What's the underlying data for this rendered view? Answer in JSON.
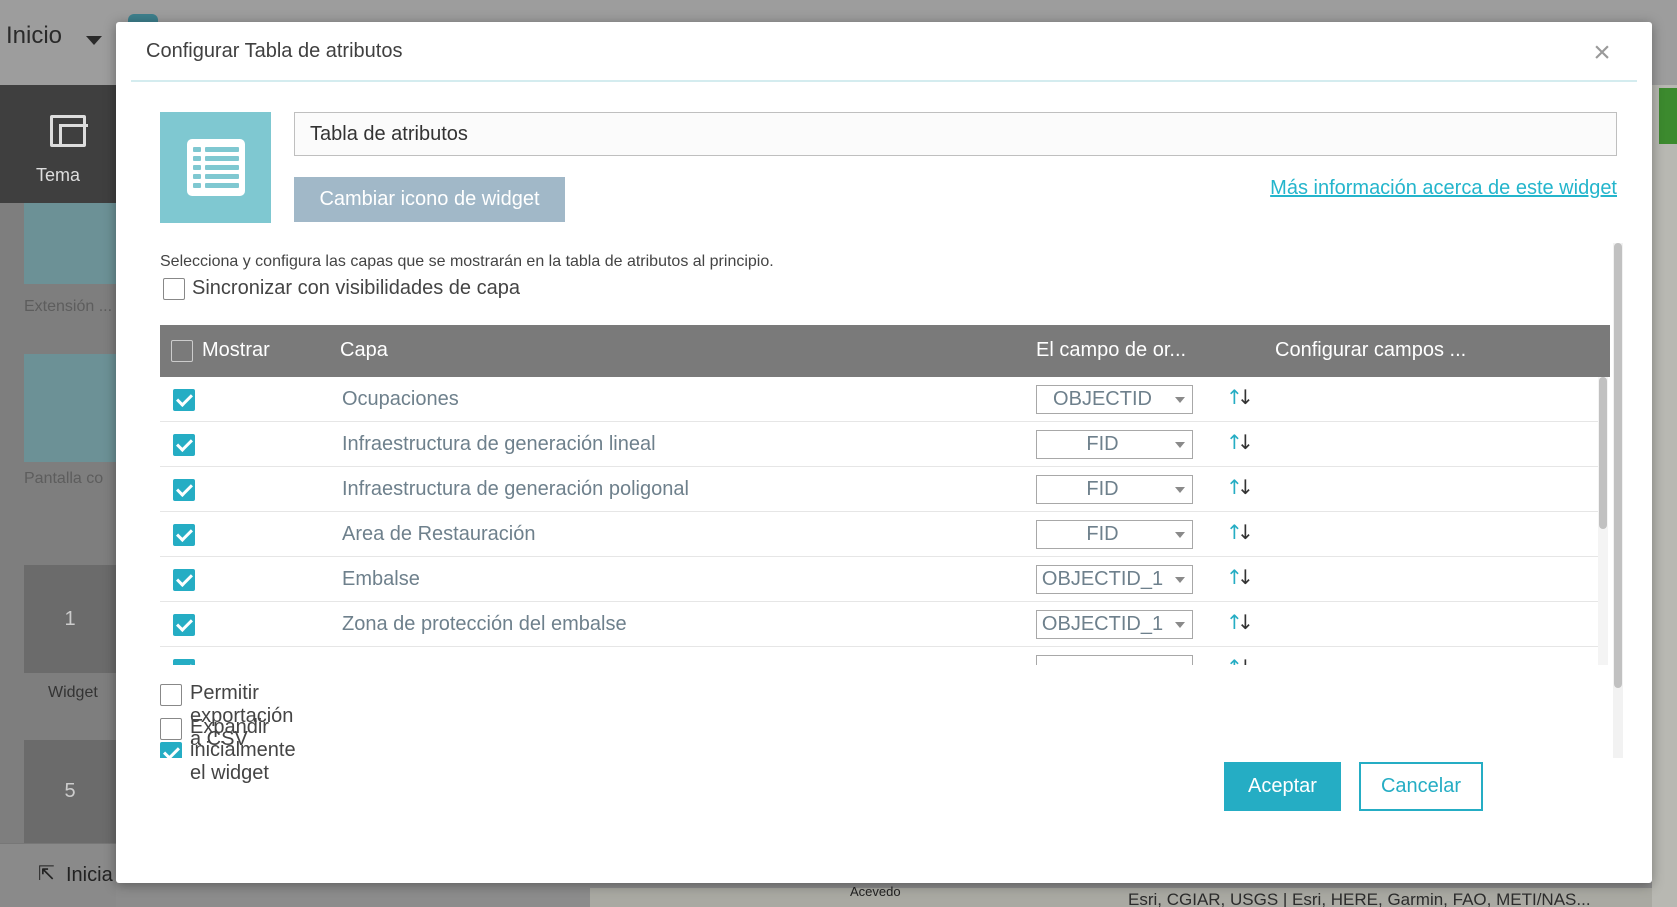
{
  "background": {
    "home_label": "Inicio",
    "sidebar": {
      "theme_label": "Tema",
      "tile_labels": [
        "Extensión ...",
        "Pantalla co",
        "Widget"
      ],
      "numbers": [
        "1",
        "5"
      ],
      "bottom_label": "Inicia"
    },
    "map": {
      "place_label": "Acevedo",
      "attribution": "Esri, CGIAR, USGS | Esri, HERE, Garmin, FAO, METI/NAS..."
    }
  },
  "dialog": {
    "title": "Configurar Tabla de atributos",
    "widget_name": "Tabla de atributos",
    "change_icon_label": "Cambiar icono de widget",
    "more_info_label": "Más información acerca de este widget",
    "description": "Selecciona y configura las capas que se mostrarán en la tabla de atributos al principio.",
    "sync_label": "Sincronizar con visibilidades de capa",
    "sync_checked": false,
    "table": {
      "headers": {
        "show": "Mostrar",
        "layer": "Capa",
        "order_field": "El campo de or...",
        "configure_fields": "Configurar campos ..."
      },
      "rows": [
        {
          "checked": true,
          "layer": "Ocupaciones",
          "field": "OBJECTID"
        },
        {
          "checked": true,
          "layer": "Infraestructura de generación lineal",
          "field": "FID"
        },
        {
          "checked": true,
          "layer": "Infraestructura de generación poligonal",
          "field": "FID"
        },
        {
          "checked": true,
          "layer": "Area de Restauración",
          "field": "FID"
        },
        {
          "checked": true,
          "layer": "Embalse",
          "field": "OBJECTID_1"
        },
        {
          "checked": true,
          "layer": "Zona de protección del embalse",
          "field": "OBJECTID_1"
        }
      ]
    },
    "options": {
      "export_csv": "Permitir exportación a CSV",
      "expand_initially": "Expandir inicialmente el widget"
    },
    "ok_label": "Aceptar",
    "cancel_label": "Cancelar"
  },
  "colors": {
    "accent": "#25adc4",
    "header_bg": "#7a7a7a",
    "icon_tile": "#7fc8d1",
    "secondary_button": "#a1b8c8"
  }
}
